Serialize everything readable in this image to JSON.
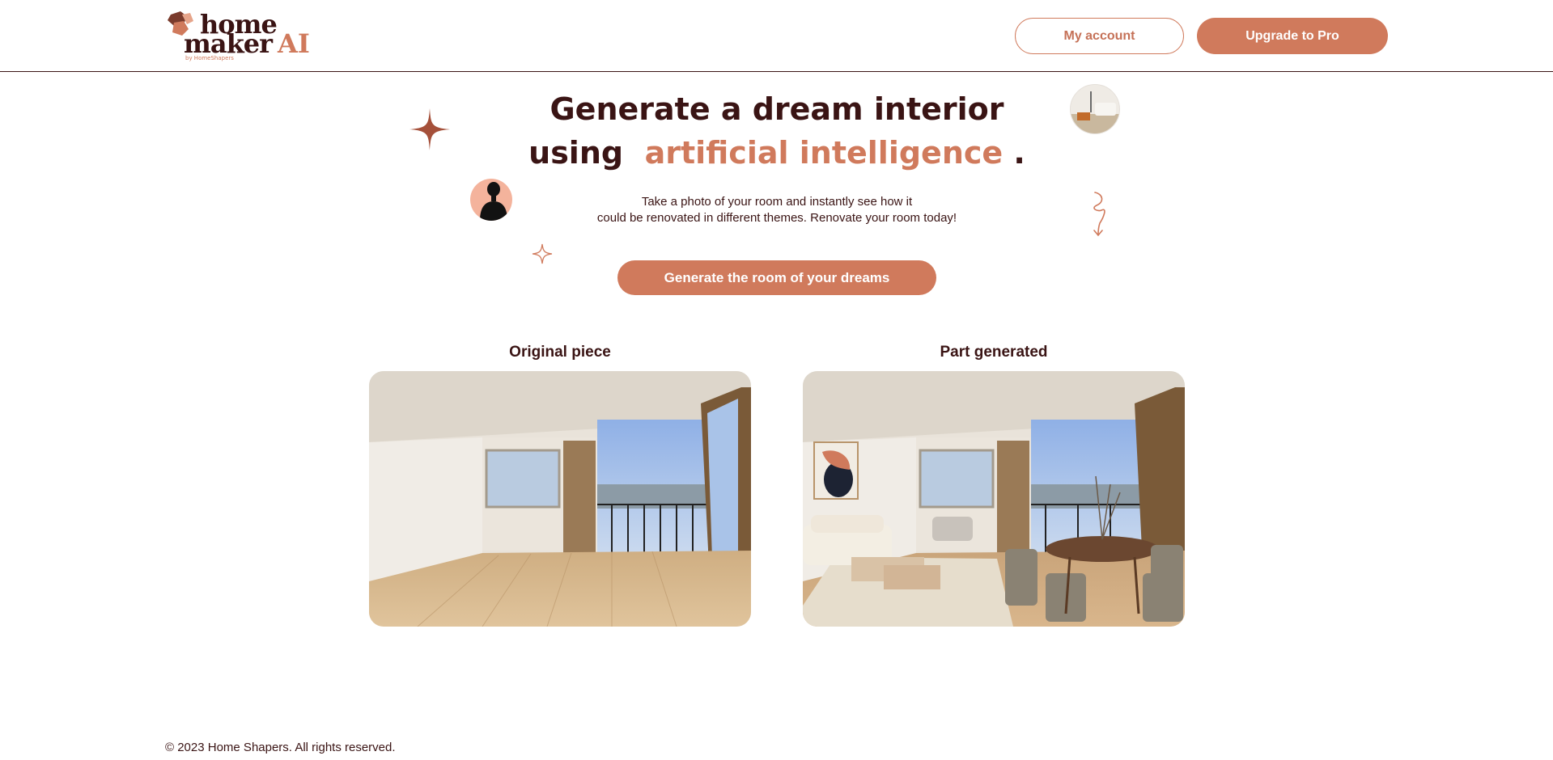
{
  "brand": {
    "name_line1": "home",
    "name_line2": "maker",
    "name_ai": "AI",
    "byline": "by HomeShapers"
  },
  "header": {
    "account_label": "My account",
    "upgrade_label": "Upgrade to Pro"
  },
  "hero": {
    "title_line1": "Generate a dream interior",
    "title_line2_prefix": "using",
    "title_line2_accent": "artificial intelligence",
    "title_line2_suffix": ".",
    "subtitle_line1": "Take a photo of your room and instantly see how it",
    "subtitle_line2": "could be renovated in different themes. Renovate your room today!",
    "cta_label": "Generate the room of your dreams"
  },
  "comparison": {
    "original_label": "Original piece",
    "generated_label": "Part generated"
  },
  "footer": {
    "copyright": "© 2023 Home Shapers. All rights reserved."
  },
  "colors": {
    "accent": "#d07a5c",
    "dark": "#3a1414",
    "background": "#ffffff"
  }
}
